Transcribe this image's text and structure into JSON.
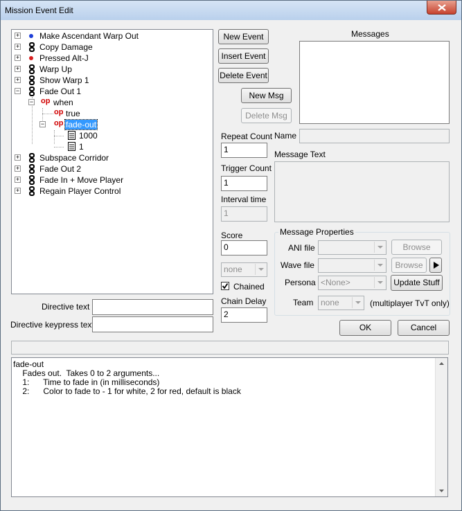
{
  "window": {
    "title": "Mission Event Edit"
  },
  "tree": [
    {
      "label": "Make Ascendant Warp Out",
      "icon": "blue-dot-icon",
      "expander": "+"
    },
    {
      "label": "Copy Damage",
      "icon": "chain-icon",
      "expander": "+"
    },
    {
      "label": "Pressed Alt-J",
      "icon": "red-dot-icon",
      "expander": "+"
    },
    {
      "label": "Warp Up",
      "icon": "chain-icon",
      "expander": "+"
    },
    {
      "label": "Show Warp 1",
      "icon": "chain-icon",
      "expander": "+"
    },
    {
      "label": "Fade Out 1",
      "icon": "chain-icon",
      "expander": "−"
    },
    {
      "label": "when",
      "icon": "op-icon",
      "expander": "−",
      "prefix": "op"
    },
    {
      "label": "true",
      "icon": "op-icon",
      "prefix": "op"
    },
    {
      "label": "fade-out",
      "icon": "op-icon",
      "expander": "−",
      "prefix": "op",
      "selected": true
    },
    {
      "label": "1000",
      "icon": "document-icon"
    },
    {
      "label": "1",
      "icon": "document-icon"
    },
    {
      "label": "Subspace Corridor",
      "icon": "chain-icon",
      "expander": "+"
    },
    {
      "label": "Fade Out 2",
      "icon": "chain-icon",
      "expander": "+"
    },
    {
      "label": "Fade In + Move Player",
      "icon": "chain-icon",
      "expander": "+"
    },
    {
      "label": "Regain Player Control",
      "icon": "chain-icon",
      "expander": "+"
    }
  ],
  "buttons": {
    "new_event": "New Event",
    "insert_event": "Insert Event",
    "delete_event": "Delete Event",
    "new_msg": "New Msg",
    "delete_msg": "Delete Msg",
    "browse_ani": "Browse",
    "browse_wave": "Browse",
    "update_stuff": "Update Stuff",
    "ok": "OK",
    "cancel": "Cancel"
  },
  "labels": {
    "messages": "Messages",
    "name": "Name",
    "message_text": "Message Text",
    "repeat_count": "Repeat Count",
    "trigger_count": "Trigger Count",
    "interval_time": "Interval time",
    "score": "Score",
    "chained": "Chained",
    "chain_delay": "Chain Delay",
    "message_properties": "Message Properties",
    "ani_file": "ANI file",
    "wave_file": "Wave file",
    "persona": "Persona",
    "team": "Team",
    "team_note": "(multiplayer TvT only)",
    "directive_text": "Directive text",
    "directive_keypress_text": "Directive keypress text"
  },
  "values": {
    "repeat_count": "1",
    "trigger_count": "1",
    "interval_time": "1",
    "score": "0",
    "team_select": "none",
    "chain_delay": "2",
    "persona": "<None>",
    "msg_team": "none",
    "chained": true
  },
  "help": {
    "lines": [
      "fade-out",
      "    Fades out.  Takes 0 to 2 arguments...",
      "    1:      Time to fade in (in milliseconds)",
      "    2:      Color to fade to - 1 for white, 2 for red, default is black"
    ]
  }
}
